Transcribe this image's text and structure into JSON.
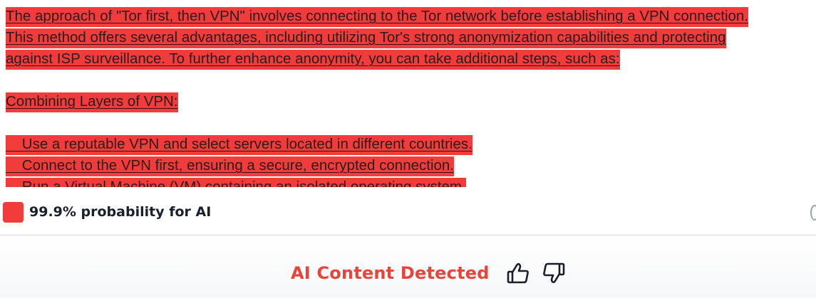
{
  "content": {
    "paragraph_lines": [
      "The approach of \"Tor first, then VPN\" involves connecting to the Tor network before establishing a VPN connection.",
      "This method offers several advantages, including utilizing Tor's strong anonymization capabilities and protecting",
      "against ISP surveillance. To further enhance anonymity, you can take additional steps, such as:"
    ],
    "section_heading": "Combining Layers of VPN:",
    "bullet_lines": [
      "    Use a reputable VPN and select servers located in different countries.",
      "    Connect to the VPN first, ensuring a secure, encrypted connection.",
      "    Run a Virtual Machine (VM) containing an isolated operating system."
    ]
  },
  "result": {
    "probability_text": "99.9% probability for AI",
    "verdict": "AI Content Detected"
  },
  "colors": {
    "highlight": "#f23c3c",
    "verdict": "#e8443a",
    "text": "#1a1f2b"
  },
  "icons": {
    "feedback_up": "thumbs-up-icon",
    "feedback_down": "thumbs-down-icon"
  }
}
